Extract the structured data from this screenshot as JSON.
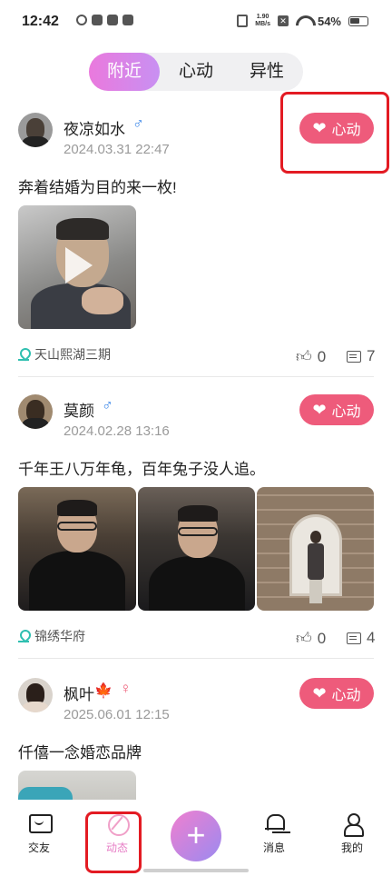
{
  "status_bar": {
    "time": "12:42",
    "net_speed": "1.90\nMB/s",
    "battery": "54%"
  },
  "tabs": [
    {
      "label": "附近",
      "active": true
    },
    {
      "label": "心动",
      "active": false
    },
    {
      "label": "异性",
      "active": false
    }
  ],
  "like_button_label": "心动",
  "posts": [
    {
      "username": "夜凉如水",
      "gender": "♂",
      "time": "2024.03.31 22:47",
      "text": "奔着结婚为目的来一枚!",
      "media": "video",
      "location": "天山熙湖三期",
      "likes": "0",
      "comments": "7"
    },
    {
      "username": "莫颜",
      "gender": "♂",
      "time": "2024.02.28 13:16",
      "text": "千年王八万年龟，百年兔子没人追。",
      "media": "photos",
      "location": "锦绣华府",
      "likes": "0",
      "comments": "4"
    },
    {
      "username": "枫叶",
      "username_emoji": "🍁",
      "gender": "♀",
      "time": "2025.06.01 12:15",
      "text": "仟僖一念婚恋品牌",
      "media": "photo"
    }
  ],
  "bottom_nav": [
    {
      "label": "交友",
      "icon": "chat-icon",
      "active": false
    },
    {
      "label": "动态",
      "icon": "leaf-icon",
      "active": true
    },
    {
      "label": "+",
      "icon": "plus-icon",
      "active": false
    },
    {
      "label": "消息",
      "icon": "bell-icon",
      "active": false
    },
    {
      "label": "我的",
      "icon": "user-icon",
      "active": false
    }
  ],
  "colors": {
    "accent_pink": "#ee5b7b",
    "tab_gradient_start": "#ea79dd",
    "tab_gradient_end": "#c890f2",
    "annotation_red": "#e31b23"
  }
}
